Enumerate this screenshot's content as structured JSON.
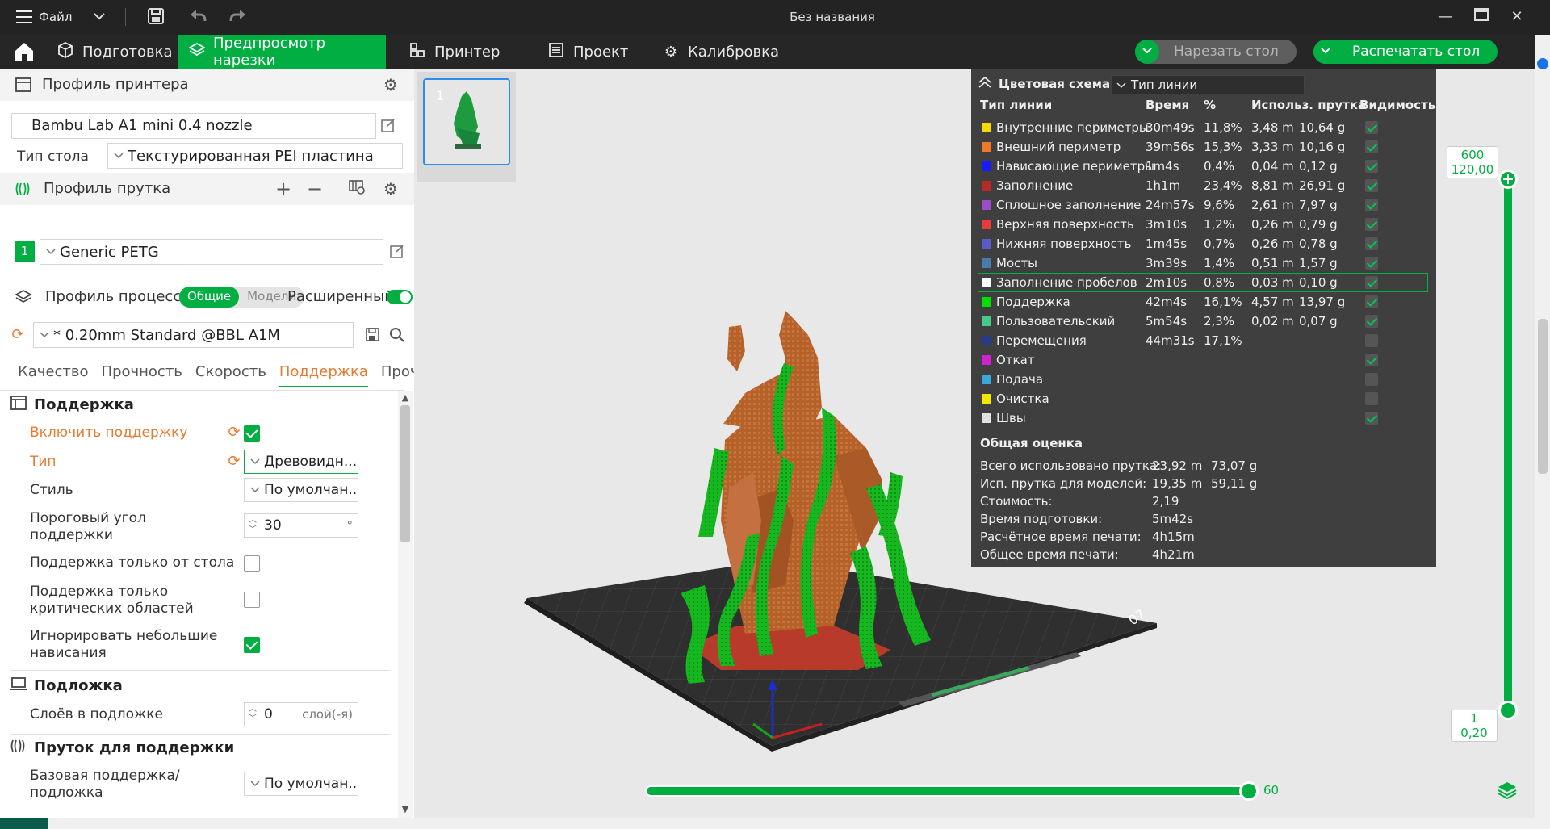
{
  "titlebar": {
    "menu_label": "Файл",
    "window_title": "Без названия"
  },
  "tabs": [
    {
      "label": "Подготовка"
    },
    {
      "label": "Предпросмотр нарезки"
    },
    {
      "label": "Принтер"
    },
    {
      "label": "Проект"
    },
    {
      "label": "Калибровка"
    }
  ],
  "actions": {
    "slice_label": "Нарезать стол",
    "print_label": "Распечатать стол"
  },
  "printer": {
    "section_title": "Профиль принтера",
    "printer_name": "Bambu Lab A1 mini 0.4 nozzle",
    "bed_label": "Тип стола",
    "bed_value": "Текстурированная PEI пластина"
  },
  "filament": {
    "section_title": "Профиль прутка",
    "slot": "1",
    "name": "Generic PETG"
  },
  "process": {
    "section_title": "Профиль процесса",
    "mode_general": "Общие",
    "mode_models": "Модели",
    "advanced_label": "Расширенный",
    "profile": "* 0.20mm Standard @BBL A1M",
    "subtabs": [
      "Качество",
      "Прочность",
      "Скорость",
      "Поддержка",
      "Прочее"
    ]
  },
  "support": {
    "group_title": "Поддержка",
    "enable_label": "Включить поддержку",
    "type_label": "Тип",
    "type_value": "Древовидн...",
    "style_label": "Стиль",
    "style_value": "По умолчан...",
    "threshold_label": "Пороговый угол поддержки",
    "threshold_value": "30",
    "threshold_unit": "°",
    "on_build_plate_label": "Поддержка только от стола",
    "critical_label": "Поддержка только критических областей",
    "ignore_small_label": "Игнорировать небольшие нависания"
  },
  "raft": {
    "group_title": "Подложка",
    "layers_label": "Слоёв в подложке",
    "layers_value": "0",
    "layers_unit": "слой(-я)"
  },
  "support_filament": {
    "group_title": "Пруток для поддержки",
    "base_label": "Базовая поддержка/подложка",
    "base_value": "По умолчан..."
  },
  "plate_thumb": {
    "number": "1"
  },
  "legend": {
    "scheme_title": "Цветовая схема",
    "scheme_value": "Тип линии",
    "headers": [
      "Тип линии",
      "Время",
      "%",
      "Использ. прутка",
      "Видимость"
    ],
    "rows": [
      {
        "name": "Внутренние периметры",
        "color": "#f5d800",
        "time": "30m49s",
        "pct": "11,8%",
        "len": "3,48 m",
        "weight": "10,64 g",
        "visible": true
      },
      {
        "name": "Внешний периметр",
        "color": "#f07828",
        "time": "39m56s",
        "pct": "15,3%",
        "len": "3,33 m",
        "weight": "10,16 g",
        "visible": true
      },
      {
        "name": "Нависающие периметры",
        "color": "#1a1aff",
        "time": "1m4s",
        "pct": "0,4%",
        "len": "0,04 m",
        "weight": "0,12 g",
        "visible": true
      },
      {
        "name": "Заполнение",
        "color": "#b82a2a",
        "time": "1h1m",
        "pct": "23,4%",
        "len": "8,81 m",
        "weight": "26,91 g",
        "visible": true
      },
      {
        "name": "Сплошное заполнение",
        "color": "#9a4dc4",
        "time": "24m57s",
        "pct": "9,6%",
        "len": "2,61 m",
        "weight": "7,97 g",
        "visible": true
      },
      {
        "name": "Верхняя поверхность",
        "color": "#e83a3a",
        "time": "3m10s",
        "pct": "1,2%",
        "len": "0,26 m",
        "weight": "0,79 g",
        "visible": true
      },
      {
        "name": "Нижняя поверхность",
        "color": "#5a5ac8",
        "time": "1m45s",
        "pct": "0,7%",
        "len": "0,26 m",
        "weight": "0,78 g",
        "visible": true
      },
      {
        "name": "Мосты",
        "color": "#4a7aa8",
        "time": "3m39s",
        "pct": "1,4%",
        "len": "0,51 m",
        "weight": "1,57 g",
        "visible": true
      },
      {
        "name": "Заполнение пробелов",
        "color": "#ffffff",
        "time": "2m10s",
        "pct": "0,8%",
        "len": "0,03 m",
        "weight": "0,10 g",
        "visible": true
      },
      {
        "name": "Поддержка",
        "color": "#00e000",
        "time": "42m4s",
        "pct": "16,1%",
        "len": "4,57 m",
        "weight": "13,97 g",
        "visible": true
      },
      {
        "name": "Пользовательский",
        "color": "#4ac88a",
        "time": "5m54s",
        "pct": "2,3%",
        "len": "0,02 m",
        "weight": "0,07 g",
        "visible": true
      },
      {
        "name": "Перемещения",
        "color": "#2a3a8a",
        "time": "44m31s",
        "pct": "17,1%",
        "len": "",
        "weight": "",
        "visible": false
      },
      {
        "name": "Откат",
        "color": "#d020d0",
        "time": "",
        "pct": "",
        "len": "",
        "weight": "",
        "visible": true
      },
      {
        "name": "Подача",
        "color": "#3aa8d8",
        "time": "",
        "pct": "",
        "len": "",
        "weight": "",
        "visible": false
      },
      {
        "name": "Очистка",
        "color": "#f5e600",
        "time": "",
        "pct": "",
        "len": "",
        "weight": "",
        "visible": false
      },
      {
        "name": "Швы",
        "color": "#e0e0e0",
        "time": "",
        "pct": "",
        "len": "",
        "weight": "",
        "visible": true
      }
    ],
    "total_title": "Общая оценка",
    "summary": [
      {
        "label": "Всего использовано прутка:",
        "v1": "23,92 m",
        "v2": "73,07 g"
      },
      {
        "label": "Исп. прутка для моделей:",
        "v1": "19,35 m",
        "v2": "59,11 g"
      },
      {
        "label": "Стоимость:",
        "v1": "2,19",
        "v2": ""
      },
      {
        "label": "Время подготовки:",
        "v1": "5m42s",
        "v2": ""
      },
      {
        "label": "Расчётное время печати:",
        "v1": "4h15m",
        "v2": ""
      },
      {
        "label": "Общее время печати:",
        "v1": "4h21m",
        "v2": ""
      }
    ]
  },
  "layer_slider": {
    "top_layer": "600",
    "top_height": "120,00",
    "bottom_layer": "1",
    "bottom_height": "0,20"
  },
  "move_slider": {
    "value": "60"
  }
}
